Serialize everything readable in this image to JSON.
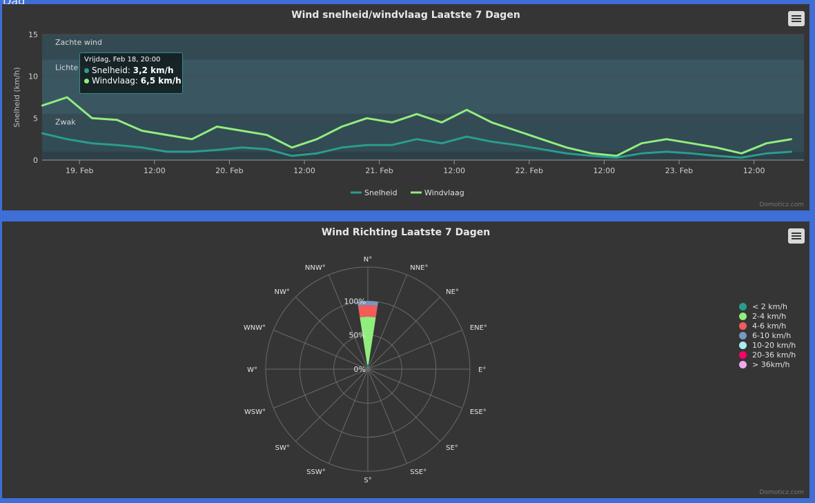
{
  "page_top_label": "Dag",
  "colors": {
    "speed": "#2a9d8f",
    "gust": "#90ee7e"
  },
  "chart1": {
    "title": "Wind snelheid/windvlaag Laatste 7 Dagen",
    "credit": "Domoticz.com"
  },
  "chart2": {
    "title": "Wind Richting Laatste 7 Dagen",
    "credit": "Domoticz.com"
  },
  "tooltip": {
    "header": "Vrijdag, Feb 18, 20:00",
    "rows": [
      {
        "label": "Snelheid",
        "value": "3,2 km/h",
        "color": "#2a9d8f"
      },
      {
        "label": "Windvlaag",
        "value": "6,5 km/h",
        "color": "#90ee7e"
      }
    ]
  },
  "wind_legend": [
    {
      "label": "< 2 km/h",
      "color": "#2a9d8f"
    },
    {
      "label": "2-4 km/h",
      "color": "#90ee7e"
    },
    {
      "label": "4-6 km/h",
      "color": "#f45b5b"
    },
    {
      "label": "6-10 km/h",
      "color": "#7798bf"
    },
    {
      "label": "10-20 km/h",
      "color": "#aaeeee"
    },
    {
      "label": "20-36 km/h",
      "color": "#ff0066"
    },
    {
      "label": "> 36km/h",
      "color": "#eeaaee"
    }
  ],
  "chart_data": [
    {
      "type": "line",
      "title": "Wind snelheid/windvlaag Laatste 7 Dagen",
      "ylabel": "Snelheid (km/h)",
      "ylim": [
        0,
        15
      ],
      "y_ticks": [
        0,
        5,
        10,
        15
      ],
      "xlim": [
        "2022-02-18 18:00",
        "2022-02-23 20:00"
      ],
      "x_ticks": [
        {
          "label": "19. Feb",
          "t": "2022-02-19 00:00"
        },
        {
          "label": "12:00",
          "t": "2022-02-19 12:00"
        },
        {
          "label": "20. Feb",
          "t": "2022-02-20 00:00"
        },
        {
          "label": "12:00",
          "t": "2022-02-20 12:00"
        },
        {
          "label": "21. Feb",
          "t": "2022-02-21 00:00"
        },
        {
          "label": "12:00",
          "t": "2022-02-21 12:00"
        },
        {
          "label": "22. Feb",
          "t": "2022-02-22 00:00"
        },
        {
          "label": "12:00",
          "t": "2022-02-22 12:00"
        },
        {
          "label": "23. Feb",
          "t": "2022-02-23 00:00"
        },
        {
          "label": "12:00",
          "t": "2022-02-23 12:00"
        }
      ],
      "plot_bands": [
        {
          "from": 0,
          "to": 1,
          "label": ""
        },
        {
          "from": 1,
          "to": 5.5,
          "label": "Zwak"
        },
        {
          "from": 5.5,
          "to": 12,
          "label": "Lichte wind"
        },
        {
          "from": 12,
          "to": 15,
          "label": "Zachte wind"
        }
      ],
      "series": [
        {
          "name": "Snelheid",
          "t": [
            "2022-02-18 18:00",
            "2022-02-18 22:00",
            "2022-02-19 02:00",
            "2022-02-19 06:00",
            "2022-02-19 10:00",
            "2022-02-19 14:00",
            "2022-02-19 18:00",
            "2022-02-19 22:00",
            "2022-02-20 02:00",
            "2022-02-20 06:00",
            "2022-02-20 10:00",
            "2022-02-20 14:00",
            "2022-02-20 18:00",
            "2022-02-20 22:00",
            "2022-02-21 02:00",
            "2022-02-21 06:00",
            "2022-02-21 10:00",
            "2022-02-21 14:00",
            "2022-02-21 18:00",
            "2022-02-21 22:00",
            "2022-02-22 02:00",
            "2022-02-22 06:00",
            "2022-02-22 10:00",
            "2022-02-22 14:00",
            "2022-02-22 18:00",
            "2022-02-22 22:00",
            "2022-02-23 02:00",
            "2022-02-23 06:00",
            "2022-02-23 10:00",
            "2022-02-23 14:00",
            "2022-02-23 18:00"
          ],
          "values": [
            3.2,
            2.5,
            2.0,
            1.8,
            1.5,
            1.0,
            1.0,
            1.2,
            1.5,
            1.3,
            0.5,
            0.8,
            1.5,
            1.8,
            1.8,
            2.5,
            2.0,
            2.8,
            2.2,
            1.8,
            1.3,
            0.8,
            0.5,
            0.3,
            0.8,
            1.0,
            0.8,
            0.5,
            0.3,
            0.8,
            1.0
          ]
        },
        {
          "name": "Windvlaag",
          "t": [
            "2022-02-18 18:00",
            "2022-02-18 22:00",
            "2022-02-19 02:00",
            "2022-02-19 06:00",
            "2022-02-19 10:00",
            "2022-02-19 14:00",
            "2022-02-19 18:00",
            "2022-02-19 22:00",
            "2022-02-20 02:00",
            "2022-02-20 06:00",
            "2022-02-20 10:00",
            "2022-02-20 14:00",
            "2022-02-20 18:00",
            "2022-02-20 22:00",
            "2022-02-21 02:00",
            "2022-02-21 06:00",
            "2022-02-21 10:00",
            "2022-02-21 14:00",
            "2022-02-21 18:00",
            "2022-02-21 22:00",
            "2022-02-22 02:00",
            "2022-02-22 06:00",
            "2022-02-22 10:00",
            "2022-02-22 14:00",
            "2022-02-22 18:00",
            "2022-02-22 22:00",
            "2022-02-23 02:00",
            "2022-02-23 06:00",
            "2022-02-23 10:00",
            "2022-02-23 14:00",
            "2022-02-23 18:00"
          ],
          "values": [
            6.5,
            7.5,
            5.0,
            4.8,
            3.5,
            3.0,
            2.5,
            4.0,
            3.5,
            3.0,
            1.5,
            2.5,
            4.0,
            5.0,
            4.5,
            5.5,
            4.5,
            6.0,
            4.5,
            3.5,
            2.5,
            1.5,
            0.8,
            0.5,
            2.0,
            2.5,
            2.0,
            1.5,
            0.8,
            2.0,
            2.5
          ]
        }
      ],
      "legend": [
        "Snelheid",
        "Windvlaag"
      ],
      "legend_position": "bottom-center"
    },
    {
      "type": "polar-stacked-bar",
      "title": "Wind Richting Laatste 7 Dagen",
      "categories": [
        "N°",
        "NNE°",
        "NE°",
        "ENE°",
        "E°",
        "ESE°",
        "SE°",
        "SSE°",
        "S°",
        "SSW°",
        "SW°",
        "WSW°",
        "W°",
        "WNW°",
        "NW°",
        "NNW°"
      ],
      "radial_ticks": [
        "0%",
        "50%",
        "100%"
      ],
      "radial_max": 150,
      "series": [
        {
          "name": "< 2 km/h",
          "values": [
            7,
            0,
            0,
            0,
            0,
            0,
            0,
            0,
            0,
            0,
            0,
            0,
            0,
            0,
            0,
            0
          ]
        },
        {
          "name": "2-4 km/h",
          "values": [
            70,
            0,
            0,
            0,
            0,
            0,
            0,
            0,
            0,
            0,
            0,
            0,
            0,
            0,
            0,
            0
          ]
        },
        {
          "name": "4-6 km/h",
          "values": [
            17,
            0,
            0,
            0,
            0,
            0,
            0,
            0,
            0,
            0,
            0,
            0,
            0,
            0,
            0,
            0
          ]
        },
        {
          "name": "6-10 km/h",
          "values": [
            6,
            0,
            0,
            0,
            0,
            0,
            0,
            0,
            0,
            0,
            0,
            0,
            0,
            0,
            0,
            0
          ]
        },
        {
          "name": "10-20 km/h",
          "values": [
            0,
            0,
            0,
            0,
            0,
            0,
            0,
            0,
            0,
            0,
            0,
            0,
            0,
            0,
            0,
            0
          ]
        },
        {
          "name": "20-36 km/h",
          "values": [
            0,
            0,
            0,
            0,
            0,
            0,
            0,
            0,
            0,
            0,
            0,
            0,
            0,
            0,
            0,
            0
          ]
        },
        {
          "name": "> 36km/h",
          "values": [
            0,
            0,
            0,
            0,
            0,
            0,
            0,
            0,
            0,
            0,
            0,
            0,
            0,
            0,
            0,
            0
          ]
        }
      ],
      "legend_position": "right"
    }
  ]
}
